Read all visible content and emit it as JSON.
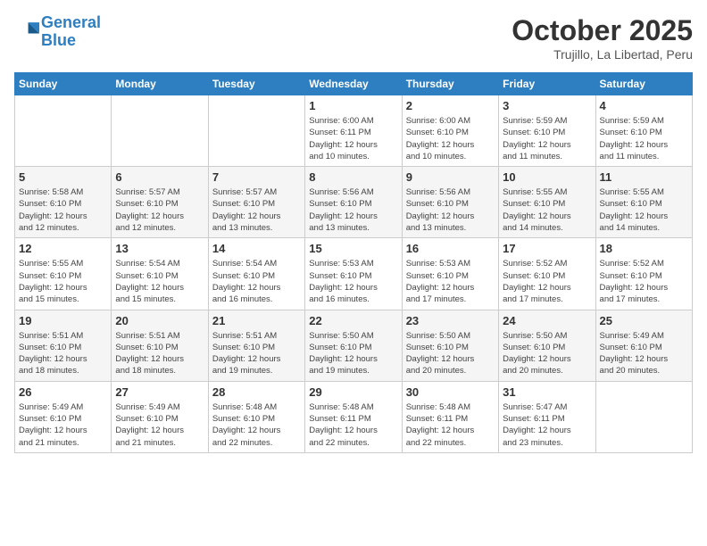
{
  "header": {
    "logo_line1": "General",
    "logo_line2": "Blue",
    "month": "October 2025",
    "location": "Trujillo, La Libertad, Peru"
  },
  "weekdays": [
    "Sunday",
    "Monday",
    "Tuesday",
    "Wednesday",
    "Thursday",
    "Friday",
    "Saturday"
  ],
  "weeks": [
    [
      {
        "day": "",
        "info": ""
      },
      {
        "day": "",
        "info": ""
      },
      {
        "day": "",
        "info": ""
      },
      {
        "day": "1",
        "info": "Sunrise: 6:00 AM\nSunset: 6:11 PM\nDaylight: 12 hours\nand 10 minutes."
      },
      {
        "day": "2",
        "info": "Sunrise: 6:00 AM\nSunset: 6:10 PM\nDaylight: 12 hours\nand 10 minutes."
      },
      {
        "day": "3",
        "info": "Sunrise: 5:59 AM\nSunset: 6:10 PM\nDaylight: 12 hours\nand 11 minutes."
      },
      {
        "day": "4",
        "info": "Sunrise: 5:59 AM\nSunset: 6:10 PM\nDaylight: 12 hours\nand 11 minutes."
      }
    ],
    [
      {
        "day": "5",
        "info": "Sunrise: 5:58 AM\nSunset: 6:10 PM\nDaylight: 12 hours\nand 12 minutes."
      },
      {
        "day": "6",
        "info": "Sunrise: 5:57 AM\nSunset: 6:10 PM\nDaylight: 12 hours\nand 12 minutes."
      },
      {
        "day": "7",
        "info": "Sunrise: 5:57 AM\nSunset: 6:10 PM\nDaylight: 12 hours\nand 13 minutes."
      },
      {
        "day": "8",
        "info": "Sunrise: 5:56 AM\nSunset: 6:10 PM\nDaylight: 12 hours\nand 13 minutes."
      },
      {
        "day": "9",
        "info": "Sunrise: 5:56 AM\nSunset: 6:10 PM\nDaylight: 12 hours\nand 13 minutes."
      },
      {
        "day": "10",
        "info": "Sunrise: 5:55 AM\nSunset: 6:10 PM\nDaylight: 12 hours\nand 14 minutes."
      },
      {
        "day": "11",
        "info": "Sunrise: 5:55 AM\nSunset: 6:10 PM\nDaylight: 12 hours\nand 14 minutes."
      }
    ],
    [
      {
        "day": "12",
        "info": "Sunrise: 5:55 AM\nSunset: 6:10 PM\nDaylight: 12 hours\nand 15 minutes."
      },
      {
        "day": "13",
        "info": "Sunrise: 5:54 AM\nSunset: 6:10 PM\nDaylight: 12 hours\nand 15 minutes."
      },
      {
        "day": "14",
        "info": "Sunrise: 5:54 AM\nSunset: 6:10 PM\nDaylight: 12 hours\nand 16 minutes."
      },
      {
        "day": "15",
        "info": "Sunrise: 5:53 AM\nSunset: 6:10 PM\nDaylight: 12 hours\nand 16 minutes."
      },
      {
        "day": "16",
        "info": "Sunrise: 5:53 AM\nSunset: 6:10 PM\nDaylight: 12 hours\nand 17 minutes."
      },
      {
        "day": "17",
        "info": "Sunrise: 5:52 AM\nSunset: 6:10 PM\nDaylight: 12 hours\nand 17 minutes."
      },
      {
        "day": "18",
        "info": "Sunrise: 5:52 AM\nSunset: 6:10 PM\nDaylight: 12 hours\nand 17 minutes."
      }
    ],
    [
      {
        "day": "19",
        "info": "Sunrise: 5:51 AM\nSunset: 6:10 PM\nDaylight: 12 hours\nand 18 minutes."
      },
      {
        "day": "20",
        "info": "Sunrise: 5:51 AM\nSunset: 6:10 PM\nDaylight: 12 hours\nand 18 minutes."
      },
      {
        "day": "21",
        "info": "Sunrise: 5:51 AM\nSunset: 6:10 PM\nDaylight: 12 hours\nand 19 minutes."
      },
      {
        "day": "22",
        "info": "Sunrise: 5:50 AM\nSunset: 6:10 PM\nDaylight: 12 hours\nand 19 minutes."
      },
      {
        "day": "23",
        "info": "Sunrise: 5:50 AM\nSunset: 6:10 PM\nDaylight: 12 hours\nand 20 minutes."
      },
      {
        "day": "24",
        "info": "Sunrise: 5:50 AM\nSunset: 6:10 PM\nDaylight: 12 hours\nand 20 minutes."
      },
      {
        "day": "25",
        "info": "Sunrise: 5:49 AM\nSunset: 6:10 PM\nDaylight: 12 hours\nand 20 minutes."
      }
    ],
    [
      {
        "day": "26",
        "info": "Sunrise: 5:49 AM\nSunset: 6:10 PM\nDaylight: 12 hours\nand 21 minutes."
      },
      {
        "day": "27",
        "info": "Sunrise: 5:49 AM\nSunset: 6:10 PM\nDaylight: 12 hours\nand 21 minutes."
      },
      {
        "day": "28",
        "info": "Sunrise: 5:48 AM\nSunset: 6:10 PM\nDaylight: 12 hours\nand 22 minutes."
      },
      {
        "day": "29",
        "info": "Sunrise: 5:48 AM\nSunset: 6:11 PM\nDaylight: 12 hours\nand 22 minutes."
      },
      {
        "day": "30",
        "info": "Sunrise: 5:48 AM\nSunset: 6:11 PM\nDaylight: 12 hours\nand 22 minutes."
      },
      {
        "day": "31",
        "info": "Sunrise: 5:47 AM\nSunset: 6:11 PM\nDaylight: 12 hours\nand 23 minutes."
      },
      {
        "day": "",
        "info": ""
      }
    ]
  ]
}
